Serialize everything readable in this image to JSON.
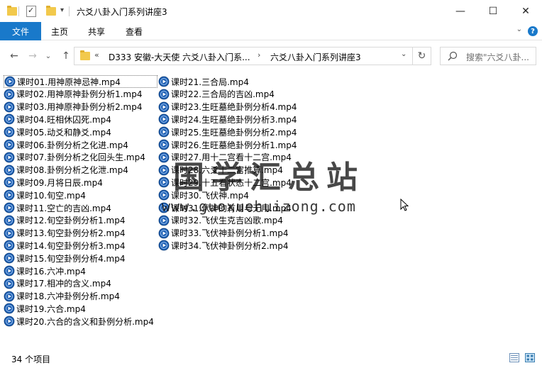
{
  "titlebar": {
    "title": "六爻八卦入门系列讲座3",
    "minimize": "—",
    "maximize": "☐",
    "close": "✕"
  },
  "ribbon": {
    "tabs": [
      "文件",
      "主页",
      "共享",
      "查看"
    ],
    "help": "?",
    "expand": "⌄"
  },
  "nav": {
    "back": "←",
    "forward": "→",
    "recent": "⌄",
    "up": "↑",
    "overflow": "«",
    "crumb1": "D333 安徽-大天使 六爻八卦入门系...",
    "crumb2": "六爻八卦入门系列讲座3",
    "refresh": "↻",
    "search_placeholder": "搜索\"六爻八卦..."
  },
  "files": [
    "课时01.用神原神忌神.mp4",
    "课时02.用神原神卦例分析1.mp4",
    "课时03.用神原神卦例分析2.mp4",
    "课时04.旺相休囚死.mp4",
    "课时05.动爻和静爻.mp4",
    "课时06.卦例分析之化进.mp4",
    "课时07.卦例分析之化回头生.mp4",
    "课时08.卦例分析之化泄.mp4",
    "课时09.月将日辰.mp4",
    "课时10.旬空.mp4",
    "课时11.空亡的吉凶.mp4",
    "课时12.旬空卦例分析1.mp4",
    "课时13.旬空卦例分析2.mp4",
    "课时14.旬空卦例分析3.mp4",
    "课时15.旬空卦例分析4.mp4",
    "课时16.六冲.mp4",
    "课时17.相冲的含义.mp4",
    "课时18.六冲卦例分析.mp4",
    "课时19.六合.mp4",
    "课时20.六合的含义和卦例分析.mp4",
    "课时21.三合局.mp4",
    "课时22.三合局的吉凶.mp4",
    "课时23.生旺墓绝卦例分析4.mp4",
    "课时24.生旺墓绝卦例分析3.mp4",
    "课时25.生旺墓绝卦例分析2.mp4",
    "课时26.生旺墓绝卦例分析1.mp4",
    "课时27.用十二宫看十二宫.mp4",
    "课时28.六爻十二宫推算.mp4",
    "课时29.十五看状态十二宫.mp4",
    "课时30.飞伏神.mp4",
    "课时31.伏神的有用与无用.mp4",
    "课时32.飞伏生克吉凶歌.mp4",
    "课时33.飞伏神卦例分析1.mp4",
    "课时34.飞伏神卦例分析2.mp4"
  ],
  "watermark": {
    "text": "国学汇总站",
    "url": "www.guoxuehuizong.com"
  },
  "status": {
    "count": "34 个项目"
  },
  "colors": {
    "accent": "#1979ca",
    "folder": "#f2c94c",
    "media_icon": "#1e5fb3"
  }
}
